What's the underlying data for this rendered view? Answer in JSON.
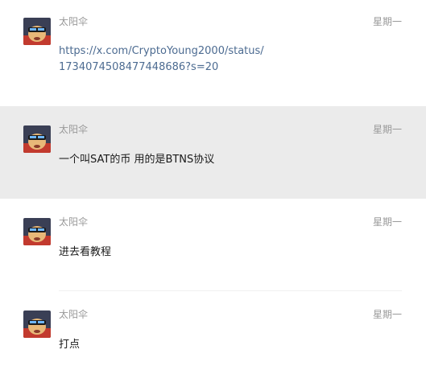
{
  "messages": [
    {
      "sender": "太阳伞",
      "time": "星期一",
      "link_line1": "https://x.com/CryptoYoung2000/status/",
      "link_line2": "1734074508477448686?s=20",
      "selected": false
    },
    {
      "sender": "太阳伞",
      "time": "星期一",
      "text": "一个叫SAT的币 用的是BTNS协议",
      "selected": true
    },
    {
      "sender": "太阳伞",
      "time": "星期一",
      "text": "进去看教程",
      "selected": false
    },
    {
      "sender": "太阳伞",
      "time": "星期一",
      "text": "打点",
      "selected": false
    }
  ],
  "colors": {
    "selected_bg": "#ebebeb",
    "link": "#4c6b91",
    "meta": "#999999"
  },
  "icons": {
    "avatar": "avatar-icon"
  }
}
